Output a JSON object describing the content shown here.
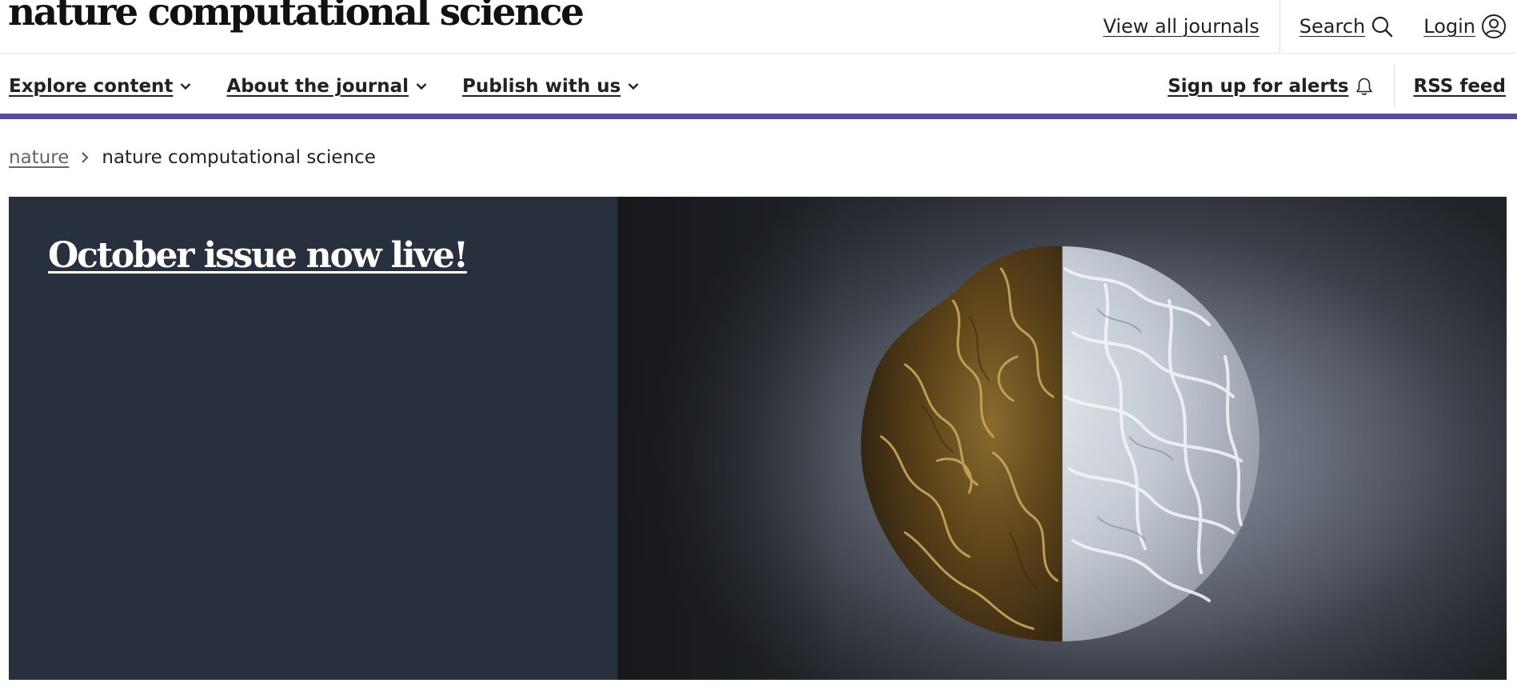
{
  "header": {
    "logo": "nature computational science",
    "view_all_journals": "View all journals",
    "search": "Search",
    "login": "Login"
  },
  "nav": {
    "explore_content": "Explore content",
    "about_journal": "About the journal",
    "publish_with_us": "Publish with us",
    "sign_up_alerts": "Sign up for alerts",
    "rss_feed": "RSS feed"
  },
  "breadcrumb": {
    "root": "nature",
    "current": "nature computational science"
  },
  "hero": {
    "title": "October issue now live!"
  },
  "colors": {
    "accent_bar": "#5a4a94",
    "hero_panel": "#29303d"
  },
  "icons": {
    "search": "search-icon",
    "login": "user-circle-icon",
    "alerts": "bell-icon",
    "dropdown": "chevron-down-icon",
    "breadcrumb_separator": "chevron-right-icon"
  }
}
